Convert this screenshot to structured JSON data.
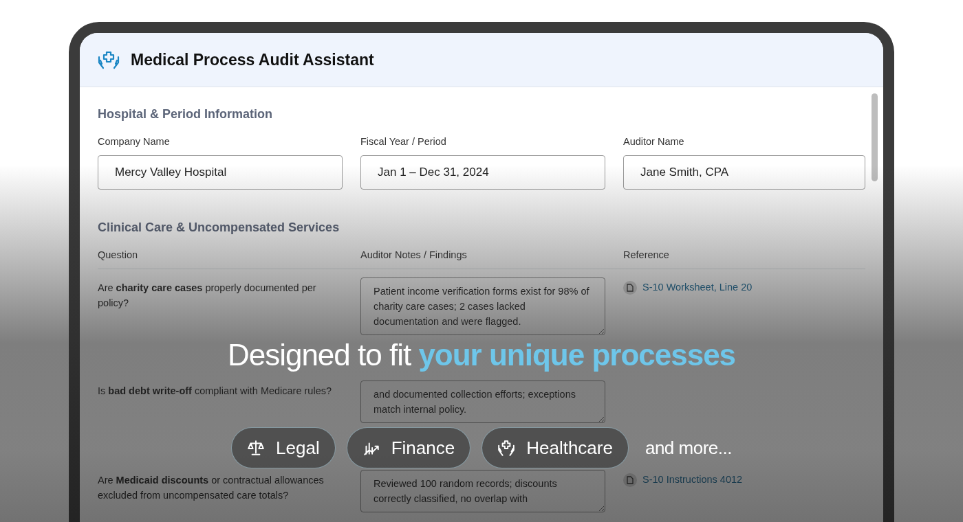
{
  "app": {
    "title": "Medical Process Audit Assistant"
  },
  "info_section": {
    "title": "Hospital & Period Information",
    "fields": [
      {
        "label": "Company Name",
        "value": "Mercy Valley Hospital"
      },
      {
        "label": "Fiscal Year / Period",
        "value": "Jan 1 – Dec 31, 2024"
      },
      {
        "label": "Auditor Name",
        "value": "Jane Smith, CPA"
      }
    ]
  },
  "audit_section": {
    "title": "Clinical Care & Uncompensated Services",
    "columns": [
      "Question",
      "Auditor Notes / Findings",
      "Reference"
    ],
    "rows": [
      {
        "question": "Are **charity care cases** properly documented per policy?",
        "notes": "Patient income verification forms exist for 98% of charity care cases; 2 cases lacked documentation and were flagged.",
        "reference": "S-10 Worksheet, Line 20"
      },
      {
        "question": "Is **bad debt write-off** compliant with Medicare rules?",
        "notes": "and documented collection efforts; exceptions match internal policy."
      },
      {
        "question": "Are **Medicaid discounts** or contractual allowances excluded from uncompensated care totals?",
        "notes": "Reviewed 100 random records; discounts correctly classified, no overlap with",
        "reference": "S-10 Instructions 4012"
      }
    ]
  },
  "banner": {
    "headline": "Designed to fit",
    "highlight": "your unique processes",
    "pills": [
      {
        "label": "Legal",
        "kind": "legal"
      },
      {
        "label": "Finance",
        "kind": "finance"
      },
      {
        "label": "Healthcare",
        "kind": "healthcare"
      }
    ],
    "more": "and more..."
  }
}
